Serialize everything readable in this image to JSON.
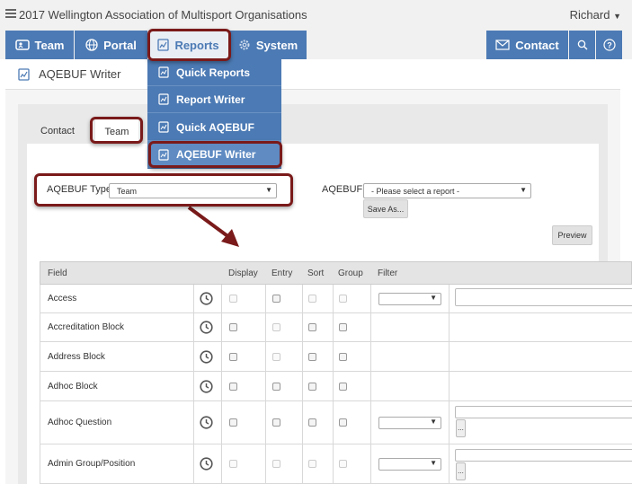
{
  "app": {
    "org_title": "2017 Wellington Association of Multisport Organisations",
    "user": "Richard"
  },
  "nav": {
    "team": "Team",
    "portal": "Portal",
    "reports": "Reports",
    "system": "System",
    "contact": "Contact"
  },
  "page": {
    "title": "AQEBUF Writer"
  },
  "reports_menu": [
    "Quick Reports",
    "Report Writer",
    "Quick AQEBUF",
    "AQEBUF Writer"
  ],
  "tabs": {
    "contact": "Contact",
    "team": "Team"
  },
  "form": {
    "type_label": "AQEBUF Type",
    "type_value": "Team",
    "report_label": "AQEBUF",
    "report_value": "- Please select a report -",
    "save_as": "Save As...",
    "preview": "Preview"
  },
  "table": {
    "headers": {
      "field": "Field",
      "display": "Display",
      "entry": "Entry",
      "sort": "Sort",
      "group": "Group",
      "filter": "Filter"
    },
    "rows": [
      {
        "name": "Access"
      },
      {
        "name": "Accreditation Block"
      },
      {
        "name": "Address Block"
      },
      {
        "name": "Adhoc Block"
      },
      {
        "name": "Adhoc Question"
      },
      {
        "name": "Admin Group/Position"
      }
    ]
  },
  "colors": {
    "nav_blue": "#4c7ab4",
    "highlight": "#7a1a1a"
  },
  "icons": [
    "list-icon",
    "team-icon",
    "globe-icon",
    "report-icon",
    "gear-icon",
    "envelope-icon",
    "search-icon",
    "help-icon",
    "history-icon"
  ]
}
